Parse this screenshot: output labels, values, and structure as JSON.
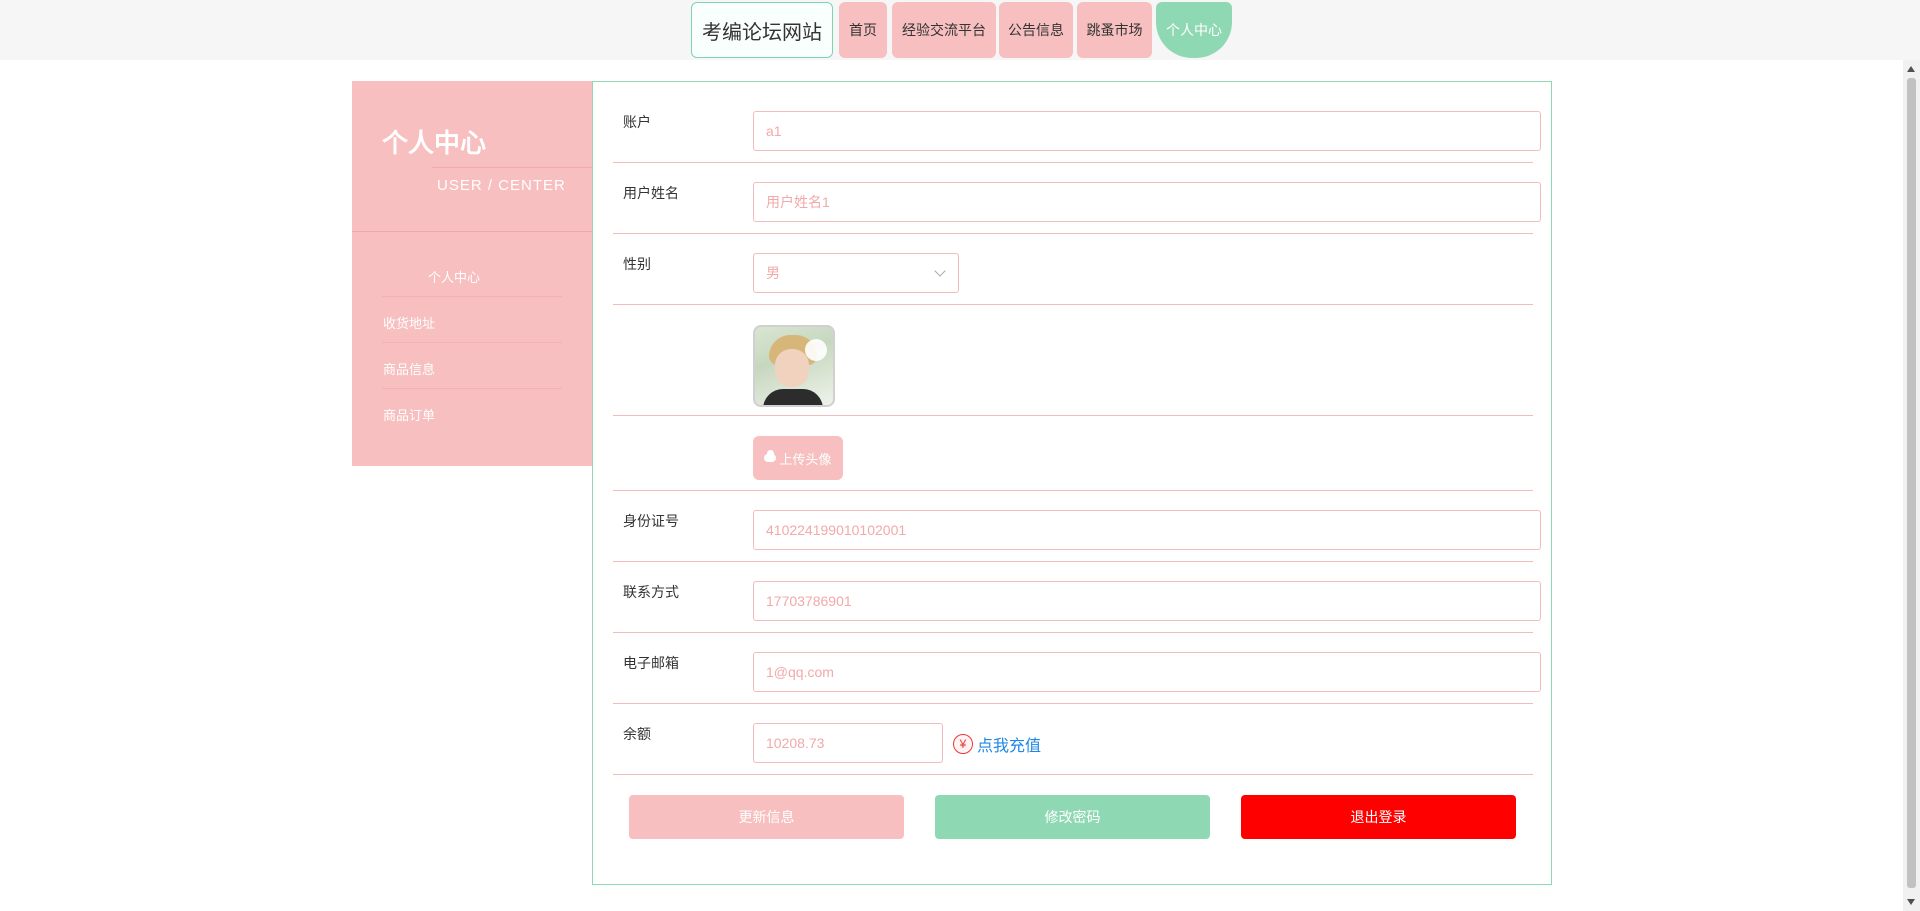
{
  "nav": {
    "logo": "考编论坛网站",
    "items": [
      "首页",
      "经验交流平台",
      "公告信息",
      "跳蚤市场",
      "个人中心"
    ]
  },
  "sidebar": {
    "title": "个人中心",
    "subtitle": "USER / CENTER",
    "menu": [
      "个人中心",
      "收货地址",
      "商品信息",
      "商品订单"
    ]
  },
  "form": {
    "account_label": "账户",
    "account_value": "a1",
    "username_label": "用户姓名",
    "username_value": "用户姓名1",
    "gender_label": "性别",
    "gender_value": "男",
    "upload_label": "上传头像",
    "idcard_label": "身份证号",
    "idcard_value": "410224199010102001",
    "phone_label": "联系方式",
    "phone_value": "17703786901",
    "email_label": "电子邮箱",
    "email_value": "1@qq.com",
    "balance_label": "余额",
    "balance_value": "10208.73",
    "recharge_label": "点我充值",
    "yen_symbol": "¥"
  },
  "buttons": {
    "update": "更新信息",
    "change_password": "修改密码",
    "logout": "退出登录"
  },
  "colors": {
    "pink": "#f7bfbf",
    "green": "#8ed8b3",
    "red": "#ff0000",
    "link": "#1e88e5"
  }
}
